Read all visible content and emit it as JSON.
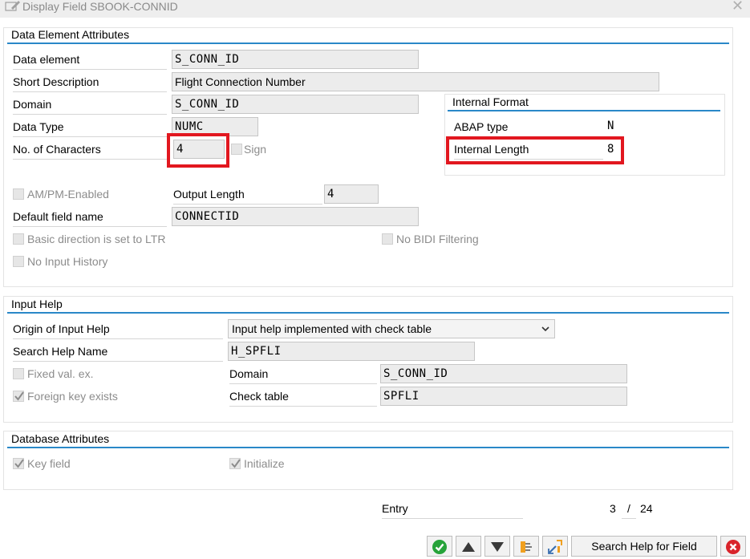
{
  "window": {
    "title": "Display Field SBOOK-CONNID"
  },
  "data_element_attributes": {
    "title": "Data Element Attributes",
    "data_element": {
      "label": "Data element",
      "value": "S_CONN_ID"
    },
    "short_description": {
      "label": "Short Description",
      "value": "Flight Connection Number"
    },
    "domain": {
      "label": "Domain",
      "value": "S_CONN_ID"
    },
    "data_type": {
      "label": "Data Type",
      "value": "NUMC"
    },
    "no_of_characters": {
      "label": "No. of Characters",
      "value": "4"
    },
    "sign": {
      "label": "Sign",
      "checked": false
    },
    "am_pm": {
      "label": "AM/PM-Enabled",
      "checked": false
    },
    "output_length": {
      "label": "Output Length",
      "value": "4"
    },
    "default_field_name": {
      "label": "Default field name",
      "value": "CONNECTID"
    },
    "basic_direction": {
      "label": "Basic direction is set to LTR",
      "checked": false
    },
    "no_bidi": {
      "label": "No BIDI Filtering",
      "checked": false
    },
    "no_input_history": {
      "label": "No Input History",
      "checked": false
    },
    "internal_format": {
      "title": "Internal Format",
      "abap_type": {
        "label": "ABAP type",
        "value": "N"
      },
      "internal_length": {
        "label": "Internal Length",
        "value": "8"
      }
    }
  },
  "input_help": {
    "title": "Input Help",
    "origin": {
      "label": "Origin of Input Help",
      "value": "Input help implemented with check table"
    },
    "search_help_name": {
      "label": "Search Help Name",
      "value": "H_SPFLI"
    },
    "fixed_val": {
      "label": "Fixed val. ex.",
      "checked": false
    },
    "foreign_key": {
      "label": "Foreign key exists",
      "checked": true
    },
    "domain": {
      "label": "Domain",
      "value": "S_CONN_ID"
    },
    "check_table": {
      "label": "Check table",
      "value": "SPFLI"
    }
  },
  "database_attributes": {
    "title": "Database Attributes",
    "key_field": {
      "label": "Key field",
      "checked": true
    },
    "initialize": {
      "label": "Initialize",
      "checked": true
    }
  },
  "entry": {
    "label": "Entry",
    "current": "3",
    "separator": "/",
    "total": "24"
  },
  "toolbar": {
    "search_help_label": "Search Help for Field",
    "icons": [
      "confirm-icon",
      "arrow-up-icon",
      "arrow-down-icon",
      "hierarchy-icon",
      "where-used-icon",
      "cancel-icon"
    ]
  },
  "colors": {
    "section_line": "#2a88c8",
    "highlight": "#e2171f",
    "field_bg": "#ececec"
  }
}
